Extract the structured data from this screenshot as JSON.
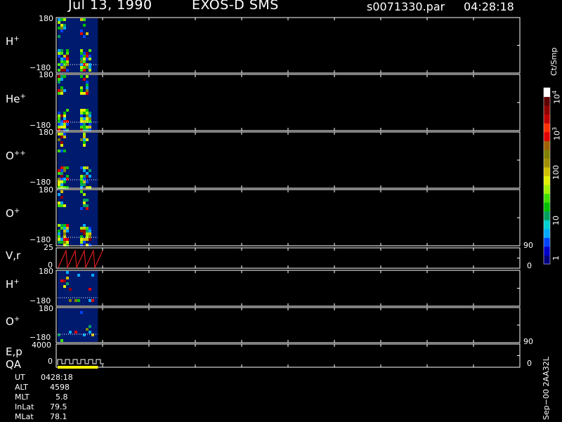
{
  "header": {
    "date": "Jul 13, 1990",
    "instrument": "EXOS-D SMS",
    "file": "s0071330.par",
    "time": "04:28:18"
  },
  "colors": {
    "background": "#000000",
    "panel_fill": "#001a6e",
    "axis": "#ffffff",
    "velocity_trace": "#ff2020",
    "qa_bar": "#ffff00"
  },
  "colorbar": {
    "unit": "Ct/Smp",
    "tick_labels": [
      "1",
      "10",
      "100",
      "10",
      "10"
    ],
    "tick_exponents": [
      "",
      "",
      "",
      "3",
      "4"
    ],
    "colors": [
      "#000080",
      "#0000cc",
      "#0044ff",
      "#00aaff",
      "#00d0d0",
      "#00a060",
      "#00c000",
      "#40e000",
      "#a0f000",
      "#e0f000",
      "#d0c000",
      "#a09000",
      "#808000",
      "#a06000",
      "#e00000",
      "#ff3000",
      "#c00000",
      "#900000",
      "#600000",
      "#ffffff"
    ]
  },
  "panels": {
    "h_plus": {
      "label": "H",
      "charge": "+",
      "y_top": "180",
      "y_bottom": "−180"
    },
    "he_plus": {
      "label": "He",
      "charge": "+",
      "y_top": "180",
      "y_bottom": "−180"
    },
    "o_plus_plus": {
      "label": "O",
      "charge": "++",
      "y_top": "180",
      "y_bottom": "−180"
    },
    "o_plus": {
      "label": "O",
      "charge": "+",
      "y_top": "180",
      "y_bottom": "−180"
    },
    "vr": {
      "label": "V,r",
      "y_top": "25",
      "y_bottom": "0",
      "right_top": "90",
      "right_bottom": "0"
    },
    "h_plus_2": {
      "label": "H",
      "charge": "+",
      "y_top": "180",
      "y_bottom": "−180"
    },
    "o_plus_2": {
      "label": "O",
      "charge": "+",
      "y_top": "180",
      "y_bottom": "−180"
    },
    "ep_qa": {
      "label_ep": "E,p",
      "label_qa": "QA",
      "y_top": "4000",
      "y_bottom": "0",
      "right_top": "90",
      "right_bottom": "0"
    }
  },
  "footer": {
    "rows": [
      {
        "label": "UT",
        "value": "0428:18"
      },
      {
        "label": "ALT",
        "value": "4598"
      },
      {
        "label": "MLT",
        "value": "5.8"
      },
      {
        "label": "InLat",
        "value": "79.5"
      },
      {
        "label": "MLat",
        "value": "78.1"
      }
    ]
  },
  "version_label": "Sep−00 2AA32L",
  "chart_data": {
    "type": "heatmap",
    "title": "Jul 13, 1990   EXOS-D SMS",
    "subtitle": "s0071330.par  04:28:18",
    "series": [
      {
        "name": "H+",
        "ylim": [
          -180,
          180
        ]
      },
      {
        "name": "He+",
        "ylim": [
          -180,
          180
        ]
      },
      {
        "name": "O++",
        "ylim": [
          -180,
          180
        ]
      },
      {
        "name": "O+",
        "ylim": [
          -180,
          180
        ]
      },
      {
        "name": "V,r",
        "ylim": [
          0,
          25
        ]
      },
      {
        "name": "H+",
        "ylim": [
          -180,
          180
        ]
      },
      {
        "name": "O+",
        "ylim": [
          -180,
          180
        ]
      },
      {
        "name": "E,p",
        "ylim": [
          0,
          4000
        ]
      }
    ],
    "colorbar_unit": "Ct/Smp",
    "colorbar_range": [
      1,
      10000
    ],
    "colorbar_scale": "log",
    "data_coverage_fraction": 0.09
  }
}
